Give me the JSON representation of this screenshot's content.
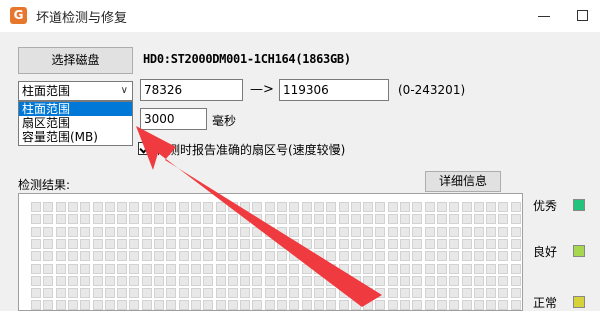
{
  "window": {
    "app_icon_glyph": "G",
    "title": "坏道检测与修复"
  },
  "toolbar": {
    "select_disk_label": "选择磁盘",
    "disk_info": "HD0:ST2000DM001-1CH164(1863GB)"
  },
  "range_mode": {
    "selected": "柱面范围",
    "options": [
      "柱面范围",
      "扇区范围",
      "容量范围(MB)"
    ]
  },
  "range": {
    "start_value": "78326",
    "arrow": "—>",
    "end_value": "119306",
    "hint": "(0-243201)"
  },
  "timeout": {
    "value": "3000",
    "unit": "毫秒"
  },
  "options": {
    "report_accurate_sector_label": "检测时报告准确的扇区号(速度较慢)",
    "report_accurate_sector_checked": true
  },
  "results": {
    "label": "检测结果:",
    "details_button": "详细信息",
    "legend": [
      {
        "label": "优秀",
        "color": "#22c37a"
      },
      {
        "label": "良好",
        "color": "#a5d84e"
      },
      {
        "label": "正常",
        "color": "#d8d23a"
      }
    ]
  },
  "colors": {
    "highlight": "#0078d7",
    "annotation_arrow": "#ef3b3f"
  }
}
